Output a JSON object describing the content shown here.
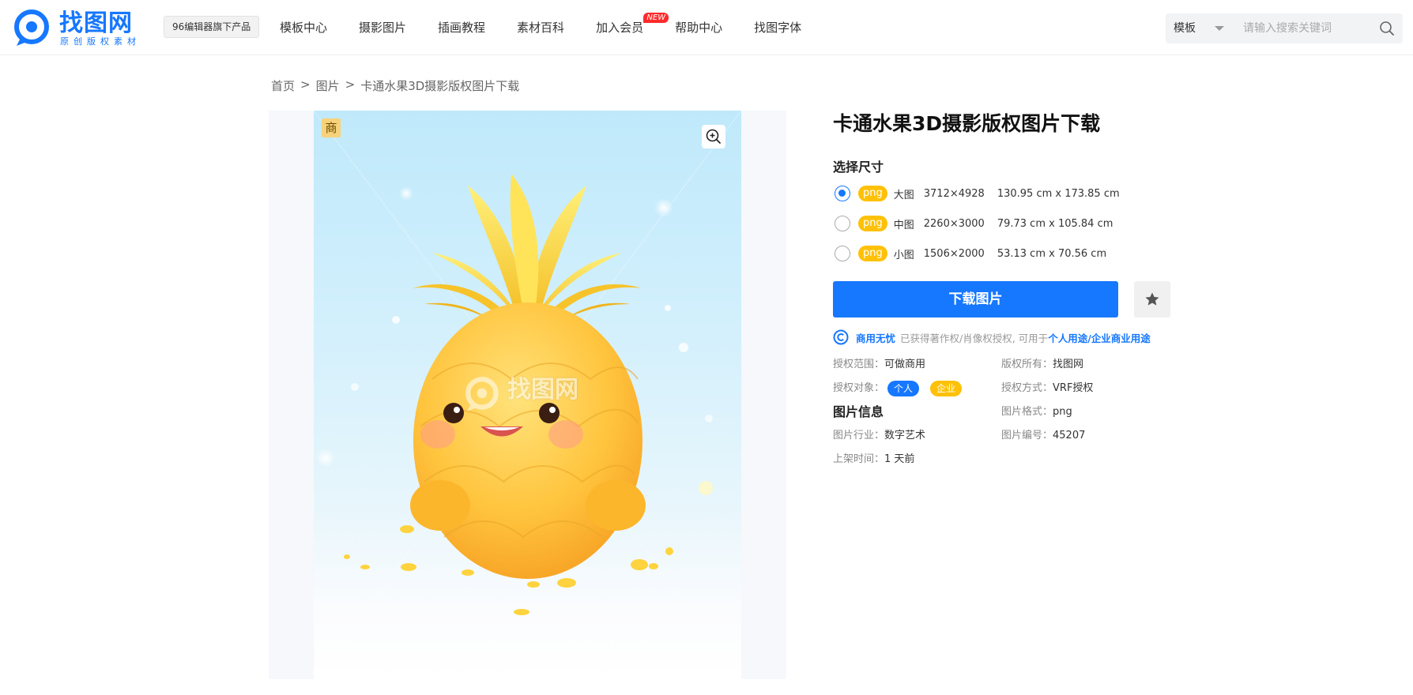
{
  "header": {
    "logo_text": "找图网",
    "logo_subtitle": "原创版权素材",
    "product_tag": "96编辑器旗下产品",
    "nav": [
      "模板中心",
      "摄影图片",
      "插画教程",
      "素材百科",
      "加入会员",
      "帮助中心",
      "找图字体"
    ],
    "new_badge": "NEW",
    "search": {
      "category": "模板",
      "placeholder": "请输入搜索关键词"
    }
  },
  "breadcrumb": {
    "items": [
      "首页",
      "图片",
      "卡通水果3D摄影版权图片下载"
    ],
    "separator": ">"
  },
  "preview": {
    "commercial_badge": "商",
    "watermark_text": "找图网",
    "watermark_subtitle": "原创版权素材"
  },
  "detail": {
    "title": "卡通水果3D摄影版权图片下载",
    "size_section_label": "选择尺寸",
    "sizes": [
      {
        "format": "png",
        "name": "大图",
        "pixels": "3712×4928",
        "cm": "130.95 cm x 173.85 cm",
        "selected": true
      },
      {
        "format": "png",
        "name": "中图",
        "pixels": "2260×3000",
        "cm": "79.73 cm x 105.84 cm",
        "selected": false
      },
      {
        "format": "png",
        "name": "小图",
        "pixels": "1506×2000",
        "cm": "53.13 cm x 70.56 cm",
        "selected": false
      }
    ],
    "download_label": "下载图片",
    "license": {
      "strong": "商用无忧",
      "desc": "已获得著作权/肖像权授权, 可用于",
      "link": "个人用途/企业商业用途"
    },
    "meta": {
      "scope_k": "授权范围：",
      "scope_v": "可做商用",
      "owner_k": "版权所有：",
      "owner_v": "找图网",
      "target_k": "授权对象：",
      "target_personal": "个人",
      "target_enterprise": "企业",
      "method_k": "授权方式：",
      "method_v": "VRF授权",
      "info_heading": "图片信息",
      "format_k": "图片格式：",
      "format_v": "png",
      "industry_k": "图片行业：",
      "industry_v": "数字艺术",
      "id_k": "图片编号：",
      "id_v": "45207",
      "time_k": "上架时间：",
      "time_v": "1 天前"
    }
  },
  "colors": {
    "brand": "#1677ff",
    "accent_yellow": "#ffc107",
    "new_red": "#ff2a2a"
  }
}
